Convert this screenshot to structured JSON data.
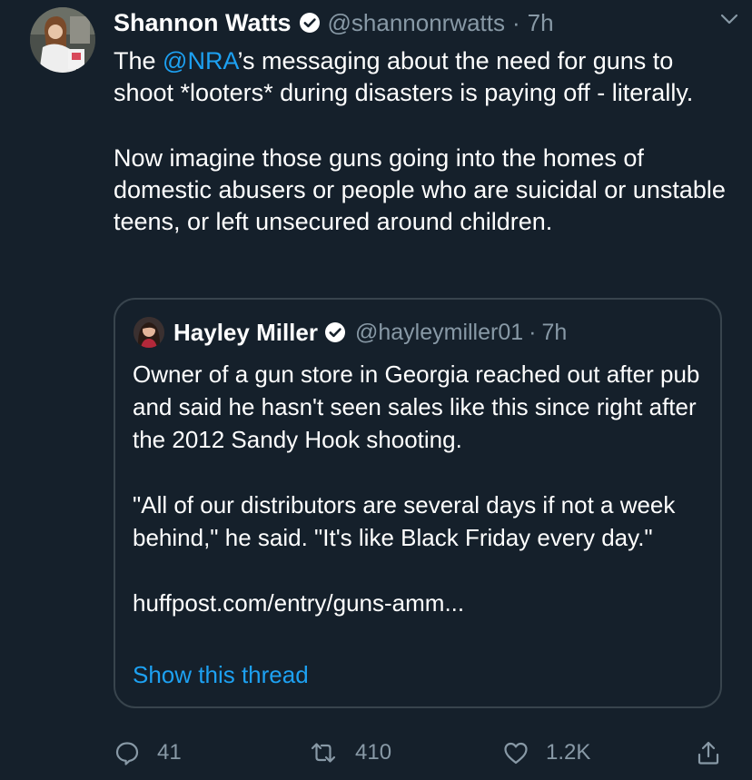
{
  "tweet": {
    "author_name": "Shannon Watts",
    "author_handle": "@shannonrwatts",
    "dot": "·",
    "time": "7h",
    "text_pre_mention": "The ",
    "mention": "@NRA",
    "text_post_mention": "’s messaging about the need for guns to shoot *looters* during disasters is paying off - literally.",
    "paragraph2": "Now imagine those guns going into the homes of domestic abusers or people who are suicidal or unstable teens, or left unsecured around children."
  },
  "quote": {
    "author_name": "Hayley Miller",
    "author_handle": "@hayleymiller01",
    "dot": "·",
    "time": "7h",
    "paragraph1": "Owner of a gun store in Georgia reached out after pub and said he hasn't seen sales like this since right after the 2012 Sandy Hook shooting.",
    "paragraph2": "\"All of our distributors are several days if not a week behind,\" he said. \"It's like Black Friday every day.\"",
    "link": "huffpost.com/entry/guns-amm...",
    "show_thread": "Show this thread"
  },
  "actions": {
    "reply_count": "41",
    "retweet_count": "410",
    "like_count": "1.2K"
  },
  "colors": {
    "background": "#15202b",
    "accent": "#1da1f2",
    "muted": "#8899a6",
    "border": "#38444d"
  },
  "icons": [
    "verified-badge-icon",
    "chevron-down-icon",
    "reply-icon",
    "retweet-icon",
    "like-icon",
    "share-icon"
  ]
}
